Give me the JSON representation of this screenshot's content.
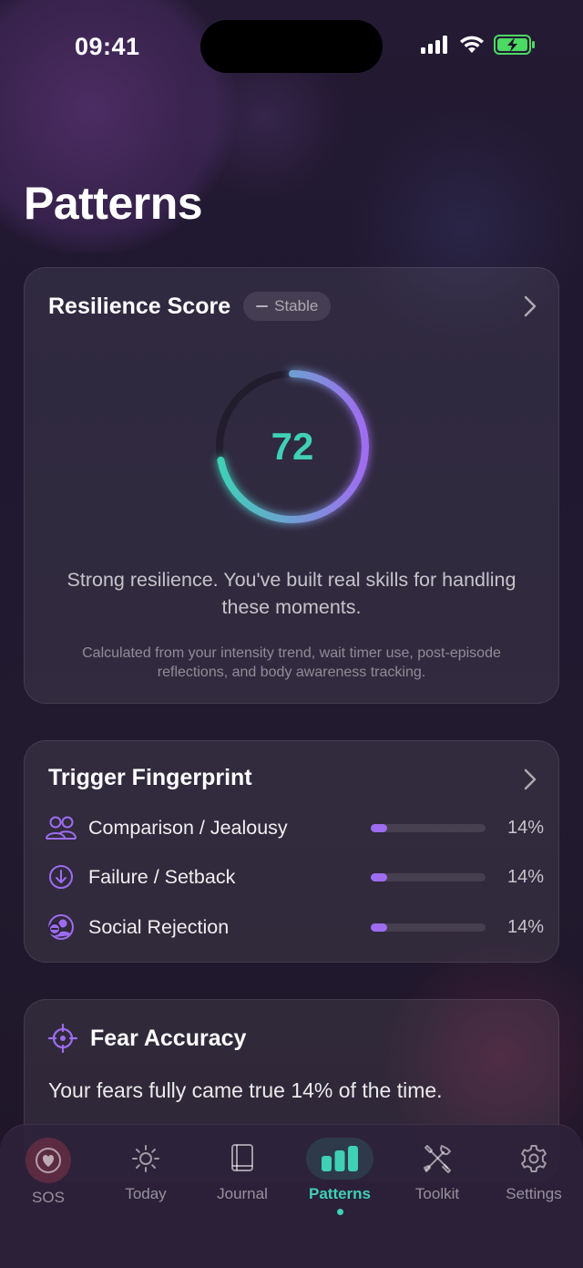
{
  "status_bar": {
    "time": "09:41"
  },
  "page": {
    "title": "Patterns"
  },
  "resilience": {
    "title": "Resilience Score",
    "trend_label": "Stable",
    "score": "72",
    "score_value": 72,
    "score_max": 100,
    "description": "Strong resilience. You've built real skills for handling these moments.",
    "note": "Calculated from your intensity trend, wait timer use, post-episode reflections, and body awareness tracking.",
    "colors": {
      "ring_start": "#3fd0b6",
      "ring_end": "#a06cf0"
    }
  },
  "triggers": {
    "title": "Trigger Fingerprint",
    "items": [
      {
        "label": "Comparison / Jealousy",
        "percent": "14%",
        "value": 0.14,
        "icon": "people-icon"
      },
      {
        "label": "Failure / Setback",
        "percent": "14%",
        "value": 0.14,
        "icon": "arrow-down-circle-icon"
      },
      {
        "label": "Social Rejection",
        "percent": "14%",
        "value": 0.14,
        "icon": "person-minus-icon"
      }
    ],
    "bar_color": "#9d6cf0"
  },
  "fear": {
    "title": "Fear Accuracy",
    "text": "Your fears fully came true 14% of the time.",
    "icon": "target-icon"
  },
  "tabs": [
    {
      "label": "SOS",
      "icon": "heart-icon"
    },
    {
      "label": "Today",
      "icon": "sun-icon"
    },
    {
      "label": "Journal",
      "icon": "book-icon"
    },
    {
      "label": "Patterns",
      "icon": "bar-chart-icon",
      "active": true
    },
    {
      "label": "Toolkit",
      "icon": "tools-icon"
    },
    {
      "label": "Settings",
      "icon": "gear-icon"
    }
  ]
}
